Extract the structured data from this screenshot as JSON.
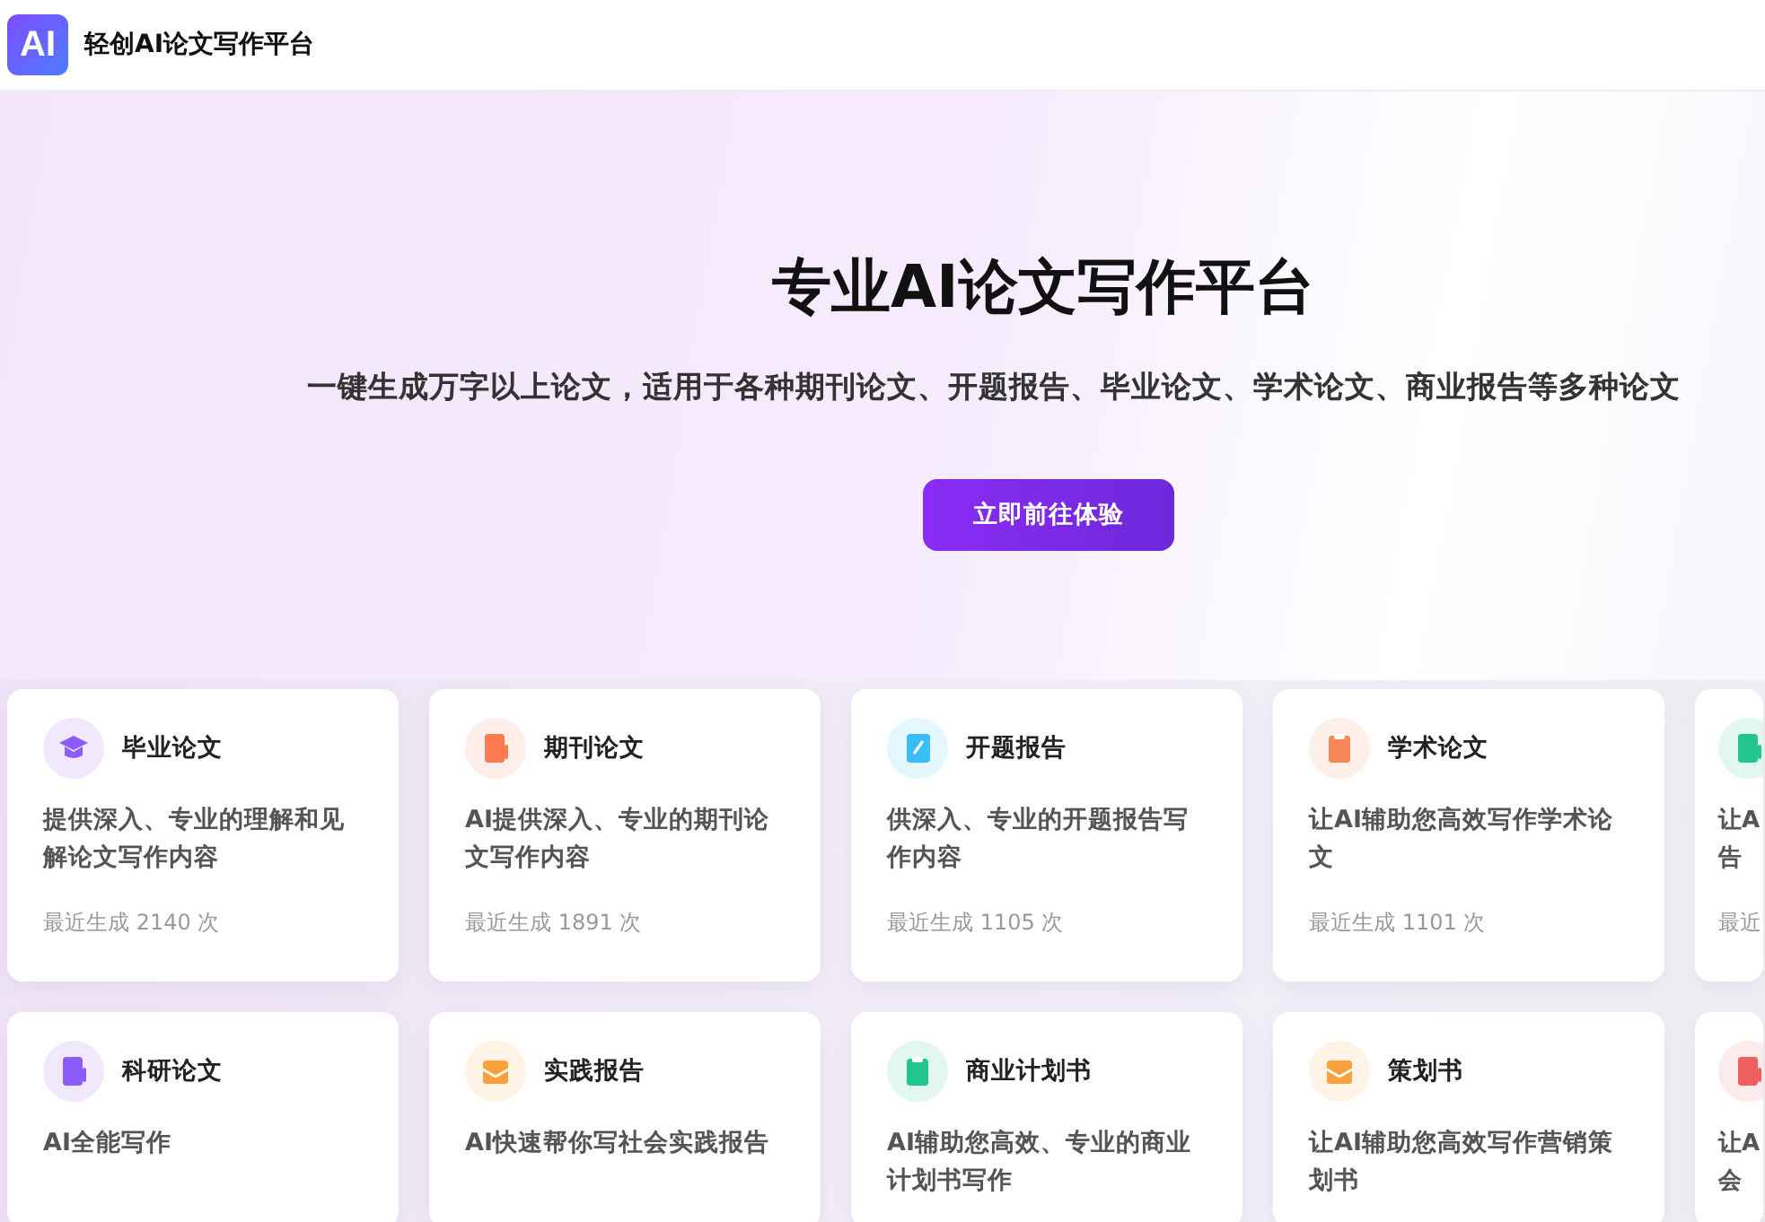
{
  "header": {
    "logo": "AI",
    "title": "轻创AI论文写作平台"
  },
  "hero": {
    "title": "专业AI论文写作平台",
    "subtitle": "一键生成万字以上论文，适用于各种期刊论文、开题报告、毕业论文、学术论文、商业报告等多种论文",
    "button": "立即前往体验"
  },
  "card_rows": [
    [
      {
        "kind": "cap",
        "color": "#8b5cf6",
        "title": "毕业论文",
        "desc": "提供深入、专业的理解和见解论文写作内容",
        "count": "最近生成 2140 次"
      },
      {
        "kind": "doc",
        "color": "#f97b4f",
        "title": "期刊论文",
        "desc": "AI提供深入、专业的期刊论文写作内容",
        "count": "最近生成 1891 次"
      },
      {
        "kind": "notebook",
        "color": "#38bdf8",
        "title": "开题报告",
        "desc": "供深入、专业的开题报告写作内容",
        "count": "最近生成 1105 次"
      },
      {
        "kind": "clipboard",
        "color": "#f6855a",
        "title": "学术论文",
        "desc": "让AI辅助您高效写作学术论文",
        "count": "最近生成 1101 次"
      },
      {
        "kind": "doc",
        "color": "#22c58b",
        "partial": true,
        "desc_lines": [
          "让A",
          "告"
        ],
        "count": "最近"
      }
    ],
    [
      {
        "kind": "doc",
        "color": "#8b5cf6",
        "title": "科研论文",
        "desc": "AI全能写作"
      },
      {
        "kind": "envelope",
        "color": "#f9a23c",
        "title": "实践报告",
        "desc": "AI快速帮你写社会实践报告"
      },
      {
        "kind": "clipboard",
        "color": "#22c58b",
        "title": "商业计划书",
        "desc": "AI辅助您高效、专业的商业计划书写作"
      },
      {
        "kind": "envelope",
        "color": "#f9a23c",
        "title": "策划书",
        "desc": "让AI辅助您高效写作营销策划书"
      },
      {
        "kind": "doc",
        "color": "#ef5f5f",
        "partial": true,
        "desc_lines": [
          "让A",
          "会"
        ]
      }
    ]
  ]
}
